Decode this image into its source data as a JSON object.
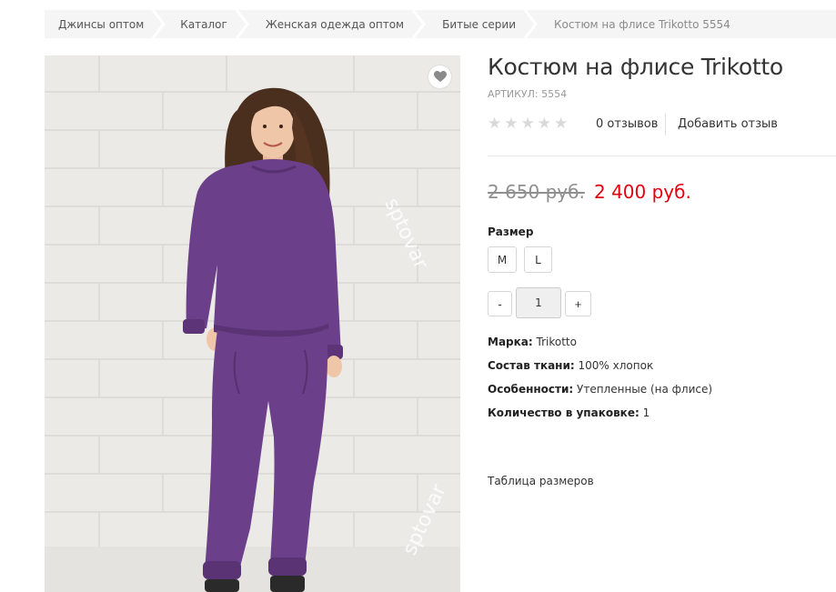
{
  "breadcrumb": [
    {
      "label": "Джинсы оптом"
    },
    {
      "label": "Каталог"
    },
    {
      "label": "Женская одежда оптом"
    },
    {
      "label": "Битые серии"
    },
    {
      "label": "Костюм на флисе Trikotto 5554"
    }
  ],
  "product": {
    "title": "Костюм на флисе Trikotto",
    "sku": "АРТИКУЛ: 5554",
    "rating": {
      "stars_filled": 0,
      "stars_total": 5
    },
    "reviews_count": "0 отзывов",
    "add_review_label": "Добавить отзыв",
    "old_price": "2 650 руб.",
    "new_price": "2 400 руб.",
    "size_label": "Размер",
    "sizes": [
      "M",
      "L"
    ],
    "qty_minus": "-",
    "qty_value": "1",
    "qty_plus": "+",
    "properties": [
      {
        "name": "Марка:",
        "value": "Trikotto"
      },
      {
        "name": "Состав ткани:",
        "value": "100% хлопок"
      },
      {
        "name": "Особенности:",
        "value": "Утепленные (на флисе)"
      },
      {
        "name": "Количество в упаковке:",
        "value": "1"
      }
    ],
    "size_table_label": "Таблица размеров",
    "watermark": "sptovar",
    "image_icon": "wishlist-heart-icon"
  },
  "colors": {
    "price_new": "#e3000f",
    "price_old": "#8f8f8f",
    "garment": "#6b3f8a",
    "breadcrumb_bg": "#f5f5f5"
  }
}
